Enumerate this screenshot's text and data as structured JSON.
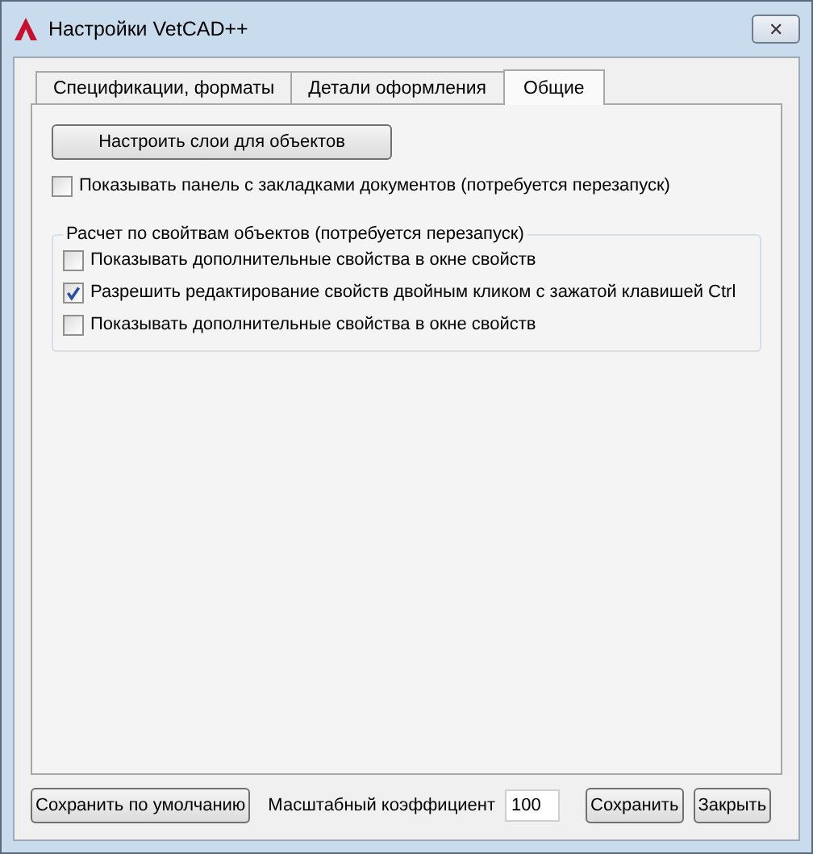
{
  "window": {
    "title": "Настройки VetCAD++",
    "close": "✕"
  },
  "tabs": [
    {
      "label": "Спецификации, форматы",
      "selected": false
    },
    {
      "label": "Детали оформления",
      "selected": false
    },
    {
      "label": "Общие",
      "selected": true
    }
  ],
  "layers_button": "Настроить слои для объектов",
  "tabs_panel_option": {
    "label": "Показывать панель с закладками документов (потребуется перезапуск)",
    "checked": false
  },
  "group": {
    "title": "Расчет по свойтвам объектов (потребуется перезапуск)",
    "options": [
      {
        "label": "Показывать дополнительные свойства в окне свойств",
        "checked": false
      },
      {
        "label": "Разрешить редактирование свойств двойным кликом с зажатой клавишей Ctrl",
        "checked": true
      },
      {
        "label": "Показывать дополнительные свойства в окне свойств",
        "checked": false
      }
    ]
  },
  "footer": {
    "default_button": "Сохранить по умолчанию",
    "scale_label": "Масштабный коэффициент",
    "scale_value": "100",
    "save_button": "Сохранить",
    "close_button": "Закрыть"
  }
}
